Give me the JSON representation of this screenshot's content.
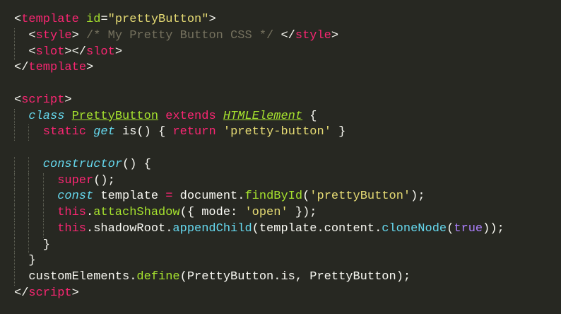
{
  "colors": {
    "background": "#272822",
    "default": "#f8f8f2",
    "tag": "#f92672",
    "attr": "#a6e22e",
    "string": "#e6db74",
    "comment": "#75715e",
    "keyword": "#66d9ef",
    "function": "#a6e22e",
    "constant": "#ae81ff",
    "guide": "#5f6155"
  },
  "code_lines": [
    {
      "indent": 0,
      "tokens": [
        {
          "t": "<",
          "c": "default"
        },
        {
          "t": "template",
          "c": "tag"
        },
        {
          "t": " ",
          "c": "default"
        },
        {
          "t": "id",
          "c": "attr"
        },
        {
          "t": "=",
          "c": "default"
        },
        {
          "t": "\"prettyButton\"",
          "c": "string"
        },
        {
          "t": ">",
          "c": "default"
        }
      ]
    },
    {
      "indent": 1,
      "tokens": [
        {
          "t": "<",
          "c": "default"
        },
        {
          "t": "style",
          "c": "tag"
        },
        {
          "t": "> ",
          "c": "default"
        },
        {
          "t": "/* My Pretty Button CSS */",
          "c": "comment"
        },
        {
          "t": " </",
          "c": "default"
        },
        {
          "t": "style",
          "c": "tag"
        },
        {
          "t": ">",
          "c": "default"
        }
      ]
    },
    {
      "indent": 1,
      "tokens": [
        {
          "t": "<",
          "c": "default"
        },
        {
          "t": "slot",
          "c": "tag"
        },
        {
          "t": "></",
          "c": "default"
        },
        {
          "t": "slot",
          "c": "tag"
        },
        {
          "t": ">",
          "c": "default"
        }
      ]
    },
    {
      "indent": 0,
      "tokens": [
        {
          "t": "</",
          "c": "default"
        },
        {
          "t": "template",
          "c": "tag"
        },
        {
          "t": ">",
          "c": "default"
        }
      ]
    },
    {
      "indent": 0,
      "tokens": []
    },
    {
      "indent": 0,
      "tokens": [
        {
          "t": "<",
          "c": "default"
        },
        {
          "t": "script",
          "c": "tag"
        },
        {
          "t": ">",
          "c": "default"
        }
      ]
    },
    {
      "indent": 1,
      "tokens": [
        {
          "t": "class",
          "c": "keyword",
          "i": true
        },
        {
          "t": " ",
          "c": "default"
        },
        {
          "t": "PrettyButton",
          "c": "function",
          "u": true
        },
        {
          "t": " ",
          "c": "default"
        },
        {
          "t": "extends",
          "c": "tag"
        },
        {
          "t": " ",
          "c": "default"
        },
        {
          "t": "HTMLElement",
          "c": "function",
          "u": true,
          "i": true
        },
        {
          "t": " {",
          "c": "default"
        }
      ]
    },
    {
      "indent": 2,
      "tokens": [
        {
          "t": "static",
          "c": "tag"
        },
        {
          "t": " ",
          "c": "default"
        },
        {
          "t": "get",
          "c": "keyword",
          "i": true
        },
        {
          "t": " is() { ",
          "c": "default"
        },
        {
          "t": "return",
          "c": "tag"
        },
        {
          "t": " ",
          "c": "default"
        },
        {
          "t": "'pretty-button'",
          "c": "string"
        },
        {
          "t": " }",
          "c": "default"
        }
      ]
    },
    {
      "indent": 0,
      "tokens": []
    },
    {
      "indent": 2,
      "tokens": [
        {
          "t": "constructor",
          "c": "keyword",
          "i": true
        },
        {
          "t": "() {",
          "c": "default"
        }
      ]
    },
    {
      "indent": 3,
      "tokens": [
        {
          "t": "super",
          "c": "tag"
        },
        {
          "t": "();",
          "c": "default"
        }
      ]
    },
    {
      "indent": 3,
      "tokens": [
        {
          "t": "const",
          "c": "keyword",
          "i": true
        },
        {
          "t": " template ",
          "c": "default"
        },
        {
          "t": "=",
          "c": "tag"
        },
        {
          "t": " document.",
          "c": "default"
        },
        {
          "t": "findById",
          "c": "function"
        },
        {
          "t": "(",
          "c": "default"
        },
        {
          "t": "'prettyButton'",
          "c": "string"
        },
        {
          "t": ");",
          "c": "default"
        }
      ]
    },
    {
      "indent": 3,
      "tokens": [
        {
          "t": "this",
          "c": "tag"
        },
        {
          "t": ".",
          "c": "default"
        },
        {
          "t": "attachShadow",
          "c": "function"
        },
        {
          "t": "({ mode: ",
          "c": "default"
        },
        {
          "t": "'open'",
          "c": "string"
        },
        {
          "t": " });",
          "c": "default"
        }
      ]
    },
    {
      "indent": 3,
      "tokens": [
        {
          "t": "this",
          "c": "tag"
        },
        {
          "t": ".shadowRoot.",
          "c": "default"
        },
        {
          "t": "appendChild",
          "c": "keyword"
        },
        {
          "t": "(template.content.",
          "c": "default"
        },
        {
          "t": "cloneNode",
          "c": "keyword"
        },
        {
          "t": "(",
          "c": "default"
        },
        {
          "t": "true",
          "c": "constant"
        },
        {
          "t": "));",
          "c": "default"
        }
      ]
    },
    {
      "indent": 2,
      "tokens": [
        {
          "t": "}",
          "c": "default"
        }
      ]
    },
    {
      "indent": 1,
      "tokens": [
        {
          "t": "}",
          "c": "default"
        }
      ]
    },
    {
      "indent": 1,
      "tokens": [
        {
          "t": "customElements.",
          "c": "default"
        },
        {
          "t": "define",
          "c": "function"
        },
        {
          "t": "(PrettyButton.is, PrettyButton);",
          "c": "default"
        }
      ]
    },
    {
      "indent": 0,
      "tokens": [
        {
          "t": "</",
          "c": "default"
        },
        {
          "t": "script",
          "c": "tag"
        },
        {
          "t": ">",
          "c": "default"
        }
      ]
    }
  ]
}
